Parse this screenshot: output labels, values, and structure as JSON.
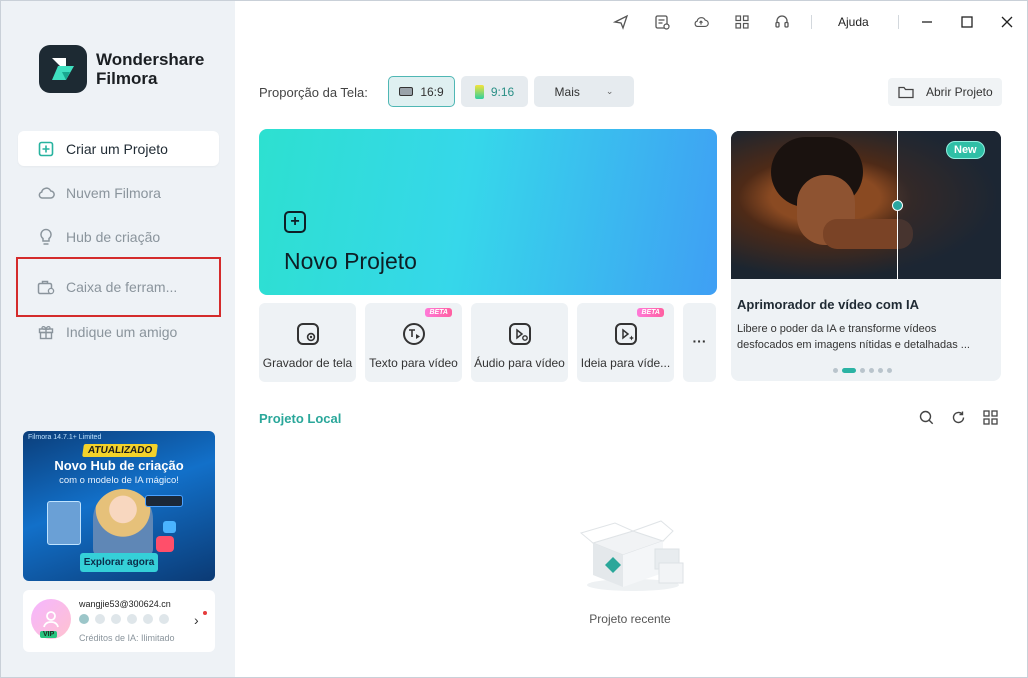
{
  "app": {
    "brand_line1": "Wondershare",
    "brand_line2": "Filmora"
  },
  "sidebar": {
    "items": [
      {
        "label": "Criar um Projeto",
        "icon": "plus-square-icon",
        "active": true
      },
      {
        "label": "Nuvem Filmora",
        "icon": "cloud-icon"
      },
      {
        "label": "Hub de criação",
        "icon": "lightbulb-icon"
      },
      {
        "label": "Caixa de ferram...",
        "icon": "toolbox-icon",
        "highlighted": true
      },
      {
        "label": "Indique um amigo",
        "icon": "gift-icon"
      }
    ],
    "promo": {
      "tag": "Filmora 14.7.1+ Limited",
      "badge": "ATUALIZADO",
      "headline": "Novo Hub de criação",
      "subline": "com o modelo de IA mágico!",
      "cta": "Explorar agora"
    },
    "user": {
      "email": "wangjie53@300624.cn",
      "badge": "VIP",
      "credits": "Créditos de IA: Ilimitado"
    }
  },
  "titlebar": {
    "help": "Ajuda",
    "icons": [
      "send-icon",
      "task-list-icon",
      "cloud-upload-icon",
      "grid-apps-icon",
      "headset-icon"
    ]
  },
  "aspect": {
    "label": "Proporção da Tela:",
    "options": [
      "16:9",
      "9:16",
      "Mais"
    ],
    "selected": "16:9"
  },
  "open_project": "Abrir Projeto",
  "new_project": "Novo Projeto",
  "tools": [
    {
      "label": "Gravador de tela",
      "beta": false
    },
    {
      "label": "Texto para vídeo",
      "beta": true
    },
    {
      "label": "Áudio para vídeo",
      "beta": false
    },
    {
      "label": "Ideia para víde...",
      "beta": true
    }
  ],
  "beta_label": "BETA",
  "more_dots": "···",
  "feature": {
    "tag": "New",
    "title": "Aprimorador de vídeo com IA",
    "description": "Libere o poder da IA e transforme vídeos desfocados em imagens nítidas e detalhadas ..."
  },
  "local": {
    "title": "Projeto Local",
    "empty": "Projeto recente"
  },
  "colors": {
    "accent": "#2aa79a",
    "highlight_border": "#d42b2b",
    "new_project_gradient_start": "#2de0d0",
    "new_project_gradient_end": "#3f9ff4"
  }
}
